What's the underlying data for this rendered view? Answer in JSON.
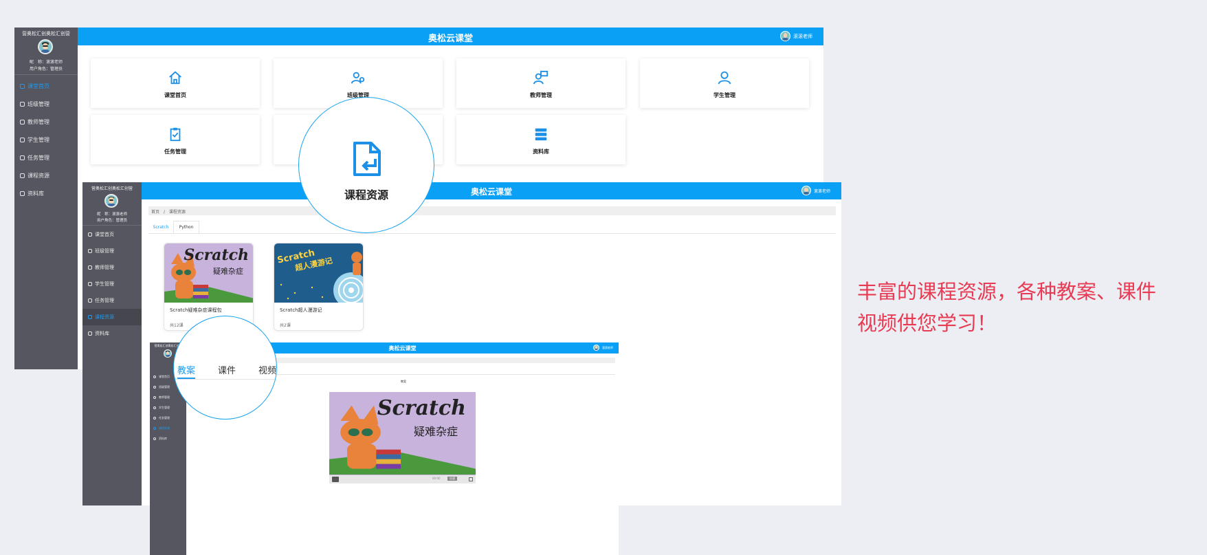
{
  "app": {
    "title": "奥松云课堂",
    "school": "营奥松汇创奥松汇创营",
    "nickname_line": "昵　称：滚滚老师",
    "role_line": "用户角色：管理员",
    "user": "滚滚老师"
  },
  "sidebar": {
    "items": [
      {
        "label": "课堂首页",
        "icon": "home-icon"
      },
      {
        "label": "班级管理",
        "icon": "class-icon"
      },
      {
        "label": "教师管理",
        "icon": "teacher-icon"
      },
      {
        "label": "学生管理",
        "icon": "student-icon"
      },
      {
        "label": "任务管理",
        "icon": "task-icon"
      },
      {
        "label": "课程资源",
        "icon": "resource-icon"
      },
      {
        "label": "资料库",
        "icon": "library-icon"
      }
    ]
  },
  "dashboard": {
    "cards": [
      {
        "label": "课堂首页",
        "icon": "home-icon"
      },
      {
        "label": "班级管理",
        "icon": "class-icon"
      },
      {
        "label": "教师管理",
        "icon": "teacher-icon"
      },
      {
        "label": "学生管理",
        "icon": "student-icon"
      },
      {
        "label": "任务管理",
        "icon": "task-icon"
      },
      {
        "label": "资料库",
        "icon": "library-icon"
      }
    ]
  },
  "zoom_resource": {
    "label": "课程资源",
    "icon": "course-resource-icon"
  },
  "resource_page": {
    "breadcrumb_home": "首页",
    "breadcrumb_sep": "/",
    "breadcrumb_current": "课程资源",
    "tabs": [
      "Scratch",
      "Python"
    ],
    "courses": [
      {
        "thumb_title": "Scratch",
        "thumb_subtitle": "疑难杂症",
        "name": "Scratch疑难杂症课程包",
        "meta": "共12课"
      },
      {
        "thumb_title": "Scratch",
        "thumb_subtitle": "超人漫游记",
        "name": "Scratch超人漫游记",
        "meta": "共2课"
      }
    ]
  },
  "zoom_tabs": {
    "tabs": [
      "教案",
      "课件",
      "视频"
    ],
    "active": "教案"
  },
  "detail_page": {
    "small_tab": "教案",
    "video_title": "Scratch",
    "video_subtitle": "疑难杂症",
    "time": "00:00",
    "speed": "倍速"
  },
  "promo": {
    "line1": "丰富的课程资源，各种教案、课件",
    "line2": "视频供您学习！"
  },
  "colors": {
    "accent": "#0aa0f5",
    "sidebar": "#555660",
    "promo": "#e83a52"
  }
}
